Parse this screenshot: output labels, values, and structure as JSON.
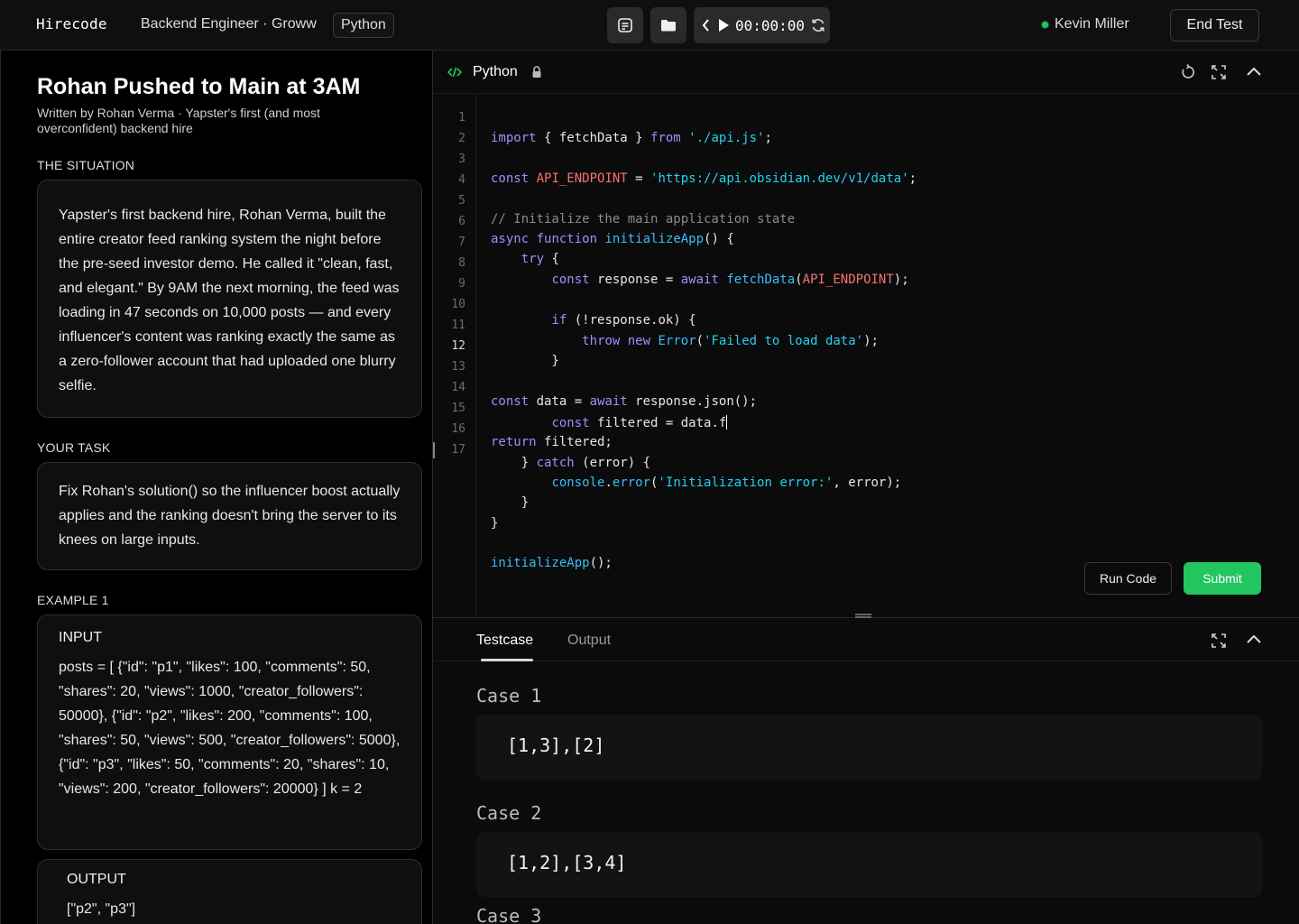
{
  "topbar": {
    "logo": "Hirecode",
    "job_title": "Backend Engineer · Groww",
    "language_chip": "Python",
    "timer": "00:00:00",
    "user_name": "Kevin Miller",
    "end_test_label": "End Test",
    "status_color": "#22c55e"
  },
  "problem": {
    "title": "Rohan Pushed to Main at 3AM",
    "subtitle": "Written by Rohan Verma · Yapster's first (and most overconfident) backend hire",
    "situation_label": "THE SITUATION",
    "situation_text": "Yapster's first backend hire, Rohan Verma, built the entire creator feed ranking system the night before the pre-seed investor demo. He called it \"clean, fast, and elegant.\" By 9AM the next morning, the feed was loading in 47 seconds on 10,000 posts — and every influencer's content was ranking exactly the same as a zero-follower account that had uploaded one blurry selfie.",
    "task_label": "YOUR TASK",
    "task_text": "Fix Rohan's solution() so the influencer boost actually applies and the ranking doesn't bring the server to its knees on large inputs.",
    "example_label": "EXAMPLE 1",
    "input_label": "INPUT",
    "input_text": "posts = [   {\"id\": \"p1\", \"likes\": 100, \"comments\": 50, \"shares\": 20, \"views\": 1000, \"creator_followers\": 50000},   {\"id\": \"p2\", \"likes\": 200, \"comments\": 100, \"shares\": 50, \"views\": 500, \"creator_followers\": 5000},   {\"id\": \"p3\", \"likes\": 50, \"comments\": 20, \"shares\": 10, \"views\": 200, \"creator_followers\": 20000} ] k = 2",
    "output_label": "OUTPUT",
    "output_text": "[\"p2\", \"p3\"]"
  },
  "editor": {
    "language": "Python",
    "line_numbers": [
      "1",
      "2",
      "3",
      "4",
      "5",
      "6",
      "7",
      "8",
      "9",
      "10",
      "11",
      "12",
      "13",
      "14",
      "15",
      "16",
      "17"
    ],
    "active_line": "12",
    "run_label": "Run Code",
    "submit_label": "Submit",
    "submit_color": "#22c55e"
  },
  "bottom": {
    "tabs": [
      "Testcase",
      "Output"
    ],
    "active_tab": "Testcase",
    "cases": [
      {
        "label": "Case 1",
        "value": "[1,3],[2]"
      },
      {
        "label": "Case 2",
        "value": "[1,2],[3,4]"
      },
      {
        "label": "Case 3",
        "value": ""
      }
    ]
  },
  "icons": [
    "notes-icon",
    "folder-icon",
    "chevron-left-icon",
    "play-icon",
    "refresh-icon",
    "code-icon",
    "lock-icon",
    "reset-icon",
    "expand-icon",
    "collapse-icon"
  ]
}
